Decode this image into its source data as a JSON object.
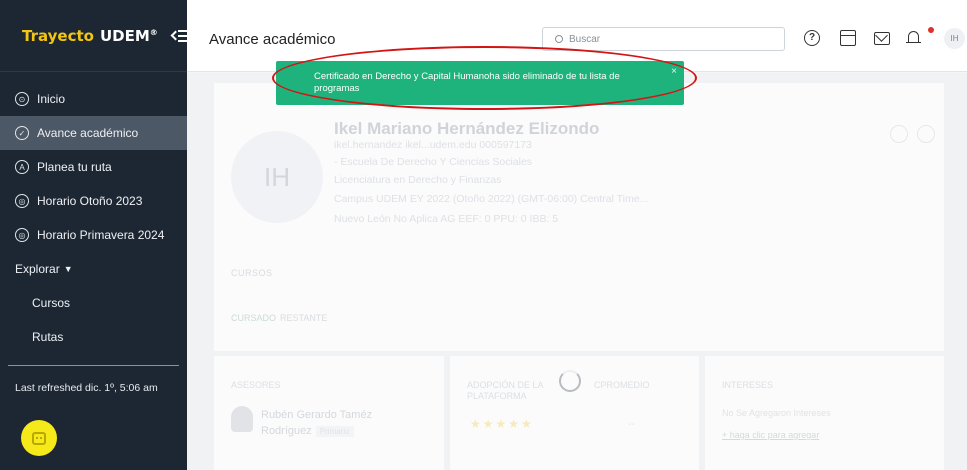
{
  "brand": {
    "name_part1": "Trayecto",
    "name_part2": "UDEM",
    "reg": "®"
  },
  "sidebar": {
    "items": [
      {
        "label": "Inicio",
        "icon": "home-icon"
      },
      {
        "label": "Avance académico",
        "icon": "check-circle-icon"
      },
      {
        "label": "Planea tu ruta",
        "icon": "route-icon"
      },
      {
        "label": "Horario Otoño 2023",
        "icon": "schedule-icon"
      },
      {
        "label": "Horario Primavera 2024",
        "icon": "schedule-icon"
      }
    ],
    "explorar": "Explorar",
    "sub_items": [
      "Cursos",
      "Rutas"
    ],
    "refreshed": "Last refreshed dic. 1º, 5:06 am"
  },
  "header": {
    "title": "Avance académico",
    "search_placeholder": "Buscar",
    "help_glyph": "?",
    "avatar_initials": "IH"
  },
  "toast": {
    "message": "Certificado en Derecho y Capital Humanoha sido eliminado de tu lista de programas",
    "close": "×"
  },
  "profile": {
    "initials": "IH",
    "name": "Ikel Mariano Hernández Elizondo",
    "email_line": "ikel.hernandez  ikel...udem.edu  000597173",
    "school": "- Escuela De Derecho Y Ciencias Sociales",
    "degree": "Licenciatura en Derecho y Finanzas",
    "campus": "Campus UDEM   EY 2022 (Otoño 2022)   (GMT-06:00) Central Time...",
    "tags": "Nuevo León   No Aplica AG   EEF: 0   PPU: 0   IBB: 5",
    "cursos_label": "CURSOS",
    "tab_cursado": "CURSADO",
    "tab_restante": "RESTANTE"
  },
  "cards": {
    "asesores_label": "ASESORES",
    "advisor_name": "Rubén Gerardo Taméz Rodríguez",
    "advisor_role": "Primario",
    "adopcion_label": "ADOPCIÓN DE LA PLATAFORMA",
    "stars": "★★★★★",
    "cpromedio_label": "CPROMEDIO",
    "cpromedio_value": "--",
    "intereses_label": "INTERESES",
    "no_intereses": "No Se Agregaron Intereses",
    "add_intereses": "+ haga clic para agregar"
  },
  "colors": {
    "sidebar_bg": "#1d2733",
    "brand_yellow": "#f3c613",
    "toast_green": "#1eb37c",
    "annotation_red": "#d41414"
  }
}
